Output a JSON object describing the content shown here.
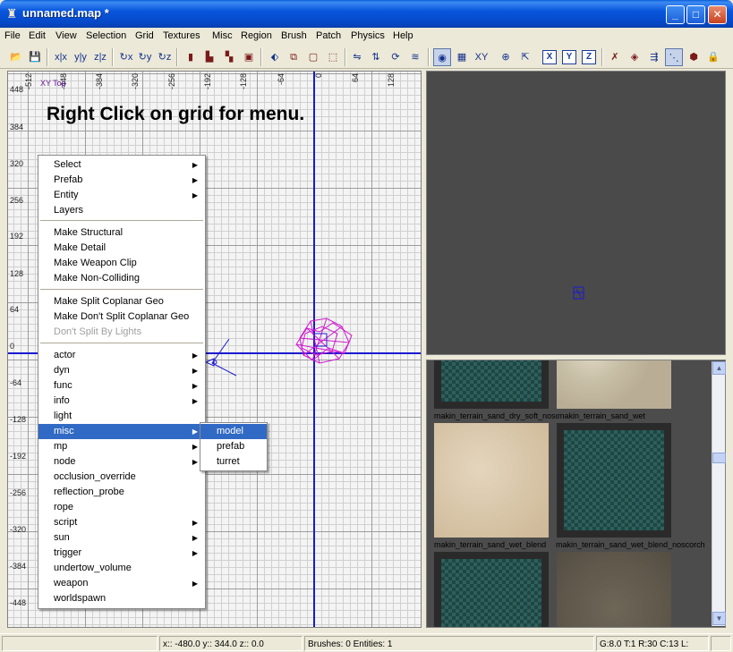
{
  "window": {
    "title": "unnamed.map *"
  },
  "menubar": {
    "items": [
      "File",
      "Edit",
      "View",
      "Selection",
      "Grid",
      "Textures",
      "Misc",
      "Region",
      "Brush",
      "Patch",
      "Physics",
      "Help"
    ]
  },
  "toolbar": {
    "axis_buttons": [
      "X",
      "Y",
      "Z"
    ]
  },
  "grid_view": {
    "viewtype_label": "XY Top",
    "hint": "Right Click on grid for menu.",
    "x_ticks": [
      "-512",
      "-448",
      "-384",
      "-320",
      "-256",
      "-192",
      "-128",
      "-64",
      "0",
      "64",
      "128"
    ],
    "y_ticks": [
      "448",
      "384",
      "320",
      "256",
      "192",
      "128",
      "64",
      "0",
      "-64",
      "-128",
      "-192",
      "-256",
      "-320",
      "-384",
      "-448"
    ]
  },
  "context_menu": {
    "group1": [
      {
        "label": "Select",
        "submenu": true
      },
      {
        "label": "Prefab",
        "submenu": true
      },
      {
        "label": "Entity",
        "submenu": true
      },
      {
        "label": "Layers",
        "submenu": false
      }
    ],
    "group2": [
      {
        "label": "Make Structural"
      },
      {
        "label": "Make Detail"
      },
      {
        "label": "Make Weapon Clip"
      },
      {
        "label": "Make Non-Colliding"
      }
    ],
    "group3": [
      {
        "label": "Make Split Coplanar Geo",
        "disabled": false
      },
      {
        "label": "Make Don't Split Coplanar Geo",
        "disabled": false
      },
      {
        "label": "Don't Split By Lights",
        "disabled": true
      }
    ],
    "group4": [
      {
        "label": "actor",
        "submenu": true
      },
      {
        "label": "dyn",
        "submenu": true
      },
      {
        "label": "func",
        "submenu": true
      },
      {
        "label": "info",
        "submenu": true
      },
      {
        "label": "light",
        "submenu": false
      },
      {
        "label": "misc",
        "submenu": true,
        "highlighted": true
      },
      {
        "label": "mp",
        "submenu": true
      },
      {
        "label": "node",
        "submenu": true
      },
      {
        "label": "occlusion_override",
        "submenu": false
      },
      {
        "label": "reflection_probe",
        "submenu": false
      },
      {
        "label": "rope",
        "submenu": false
      },
      {
        "label": "script",
        "submenu": true
      },
      {
        "label": "sun",
        "submenu": true
      },
      {
        "label": "trigger",
        "submenu": true
      },
      {
        "label": "undertow_volume",
        "submenu": false
      },
      {
        "label": "weapon",
        "submenu": true
      },
      {
        "label": "worldspawn",
        "submenu": false
      }
    ]
  },
  "submenu_misc": {
    "items": [
      {
        "label": "model",
        "highlighted": true
      },
      {
        "label": "prefab",
        "highlighted": false
      },
      {
        "label": "turret",
        "highlighted": false
      }
    ]
  },
  "texture_browser": {
    "labels": [
      "makin_terrain_sand_dry_soft_noscorch",
      "makin_terrain_sand_wet",
      "makin_terrain_sand_wet_blend",
      "makin_terrain_sand_wet_blend_noscorch"
    ]
  },
  "statusbar": {
    "coords": "x:: -480.0  y:: 344.0  z:: 0.0",
    "counts": "Brushes: 0 Entities: 1",
    "grid_info": "G:8.0 T:1 R:30 C:13 L:"
  },
  "colors": {
    "selection": "#316ac5",
    "axis": "#1a1ad0",
    "entity": "#d01ad0",
    "titlebar": "#0855dd"
  }
}
